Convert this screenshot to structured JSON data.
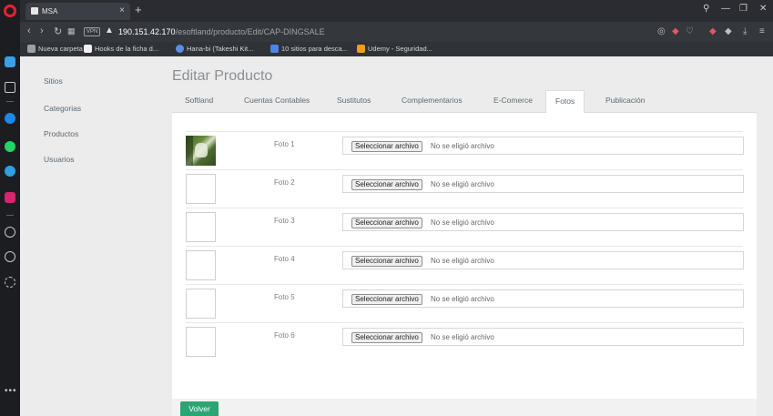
{
  "browser": {
    "tab_title": "MSA",
    "tab_close": "×",
    "new_tab": "+",
    "url_host": "190.151.42.170",
    "url_path": "/esoftland/producto/Edit/CAP-DINGSALE",
    "vpn_badge": "VPN",
    "bookmarks": [
      {
        "label": "Nueva carpeta",
        "icon_color": "#9aa0a6"
      },
      {
        "label": "Hooks de la ficha d...",
        "icon_color": "#f0f0f0"
      },
      {
        "label": "Hana-bi (Takeshi Kit...",
        "icon_color": "#5b8ee6"
      },
      {
        "label": "10 sitios para desca...",
        "icon_color": "#4a86e8"
      },
      {
        "label": "Udemy - Seguridad...",
        "icon_color": "#f29c1f"
      }
    ]
  },
  "sidebar": {
    "items": [
      {
        "label": "Sitios"
      },
      {
        "label": "Categorias"
      },
      {
        "label": "Productos"
      },
      {
        "label": "Usuarios"
      }
    ]
  },
  "page": {
    "title": "Editar Producto",
    "tabs": [
      {
        "label": "Softland",
        "active": false
      },
      {
        "label": "Cuentas Contables",
        "active": false
      },
      {
        "label": "Sustitutos",
        "active": false
      },
      {
        "label": "Complementarios",
        "active": false
      },
      {
        "label": "E-Comerce",
        "active": false
      },
      {
        "label": "Fotos",
        "active": true
      },
      {
        "label": "Publicación",
        "active": false
      }
    ],
    "photos": [
      {
        "label": "Foto 1",
        "button": "Seleccionar archivo",
        "status": "No se eligió archivo",
        "has_image": true
      },
      {
        "label": "Foto 2",
        "button": "Seleccionar archivo",
        "status": "No se eligió archivo",
        "has_image": false
      },
      {
        "label": "Foto 3",
        "button": "Seleccionar archivo",
        "status": "No se eligió archivo",
        "has_image": false
      },
      {
        "label": "Foto 4",
        "button": "Seleccionar archivo",
        "status": "No se eligió archivo",
        "has_image": false
      },
      {
        "label": "Foto 5",
        "button": "Seleccionar archivo",
        "status": "No se eligió archivo",
        "has_image": false
      },
      {
        "label": "Foto 6",
        "button": "Seleccionar archivo",
        "status": "No se eligió archivo",
        "has_image": false
      }
    ],
    "back_button": "Volver"
  },
  "colors": {
    "accent_green": "#2aa573",
    "opera_red": "#e8222d"
  }
}
